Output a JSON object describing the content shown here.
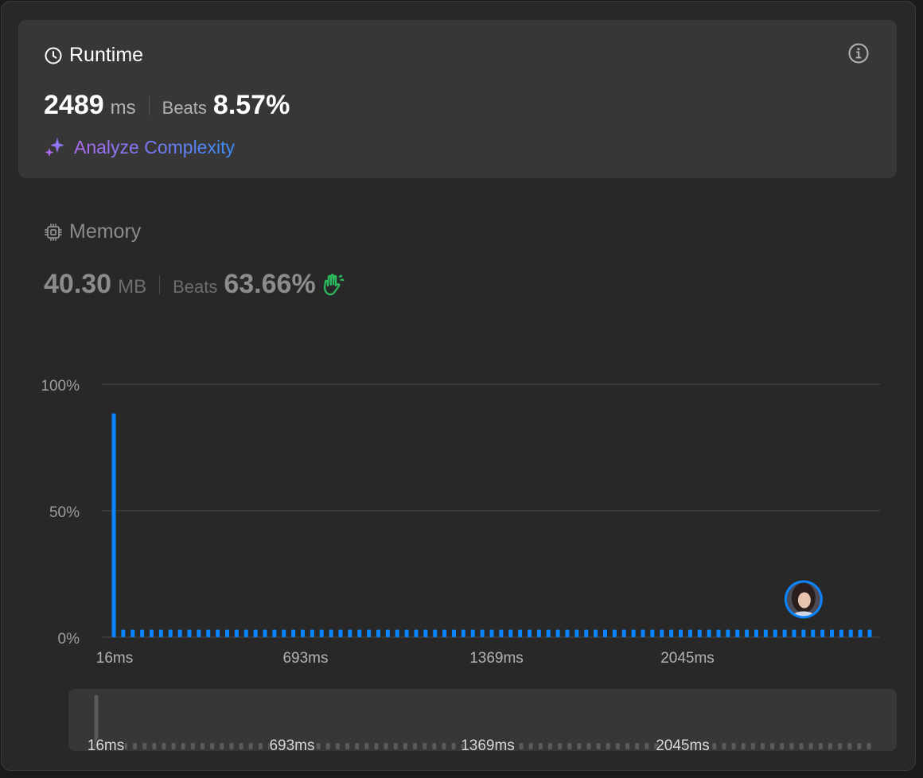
{
  "runtime": {
    "title": "Runtime",
    "value": "2489",
    "unit": "ms",
    "beats_label": "Beats",
    "beats_pct": "8.57%",
    "analyze_label": "Analyze Complexity",
    "icons": [
      "clock-icon",
      "info-icon",
      "sparkle-icon"
    ]
  },
  "memory": {
    "title": "Memory",
    "value": "40.30",
    "unit": "MB",
    "beats_label": "Beats",
    "beats_pct": "63.66%",
    "icons": [
      "cpu-chip-icon",
      "clap-icon"
    ]
  },
  "colors": {
    "bar": "#0a84ff",
    "bar_muted": "#5a5a5a",
    "clap": "#2cbb5d",
    "gradient_start": "#b06bf2",
    "gradient_end": "#3b8ef6"
  },
  "chart_data": {
    "type": "bar",
    "y_ticks": [
      "100%",
      "50%",
      "0%"
    ],
    "x_ticks": [
      "16ms",
      "693ms",
      "1369ms",
      "2045ms"
    ],
    "ylim": [
      0,
      100
    ],
    "series": [
      {
        "values": [
          88.5,
          3,
          3,
          3,
          3,
          3,
          3,
          3,
          3,
          3,
          3,
          3,
          3,
          3,
          3,
          3,
          3,
          3,
          3,
          3,
          3,
          3,
          3,
          3,
          3,
          3,
          3,
          3,
          3,
          3,
          3,
          3,
          3,
          3,
          3,
          3,
          3,
          3,
          3,
          3,
          3,
          3,
          3,
          3,
          3,
          3,
          3,
          3,
          3,
          3,
          3,
          3,
          3,
          3,
          3,
          3,
          3,
          3,
          3,
          3,
          3,
          3,
          3,
          3,
          3,
          3,
          3,
          3,
          3,
          3,
          3,
          3,
          3,
          3,
          3,
          3,
          3,
          3,
          3,
          3,
          3
        ]
      }
    ],
    "user_bar_index": 73,
    "grid": true
  },
  "scrubber": {
    "x_ticks": [
      "16ms",
      "693ms",
      "1369ms",
      "2045ms"
    ]
  }
}
